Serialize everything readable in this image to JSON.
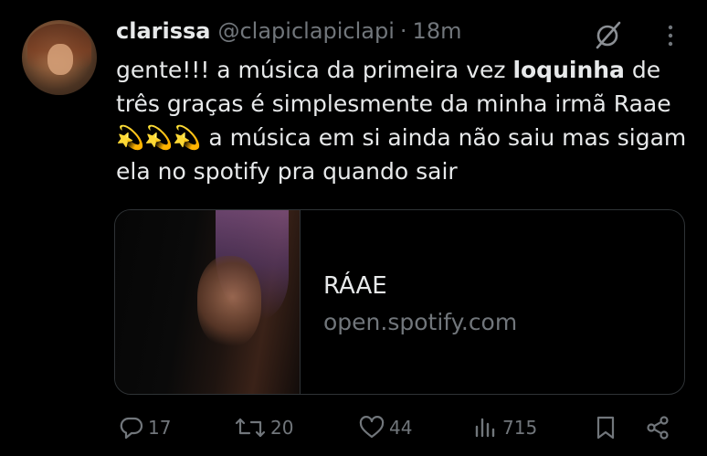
{
  "author": {
    "name": "clarissa",
    "handle": "@clapiclapiclapi",
    "separator": "·",
    "time": "18m"
  },
  "tweet": {
    "text_before": "gente!!! a música da primeira vez ",
    "text_bold": "loquinha",
    "text_after": " de três graças é simplesmente da minha irmã Raae 💫💫💫  a música em si ainda não saiu mas sigam ela no spotify pra quando sair"
  },
  "card": {
    "title": "RÁAE",
    "domain": "open.spotify.com"
  },
  "actions": {
    "replies": "17",
    "reposts": "20",
    "likes": "44",
    "views": "715"
  },
  "icons": {
    "grok": "grok-icon",
    "more": "more-vertical-icon",
    "reply": "reply-icon",
    "repost": "repost-icon",
    "like": "heart-icon",
    "views": "views-chart-icon",
    "bookmark": "bookmark-icon",
    "share": "share-icon"
  },
  "colors": {
    "background": "#000000",
    "text": "#e7e9ea",
    "muted": "#71767b",
    "border": "#2f3336"
  }
}
